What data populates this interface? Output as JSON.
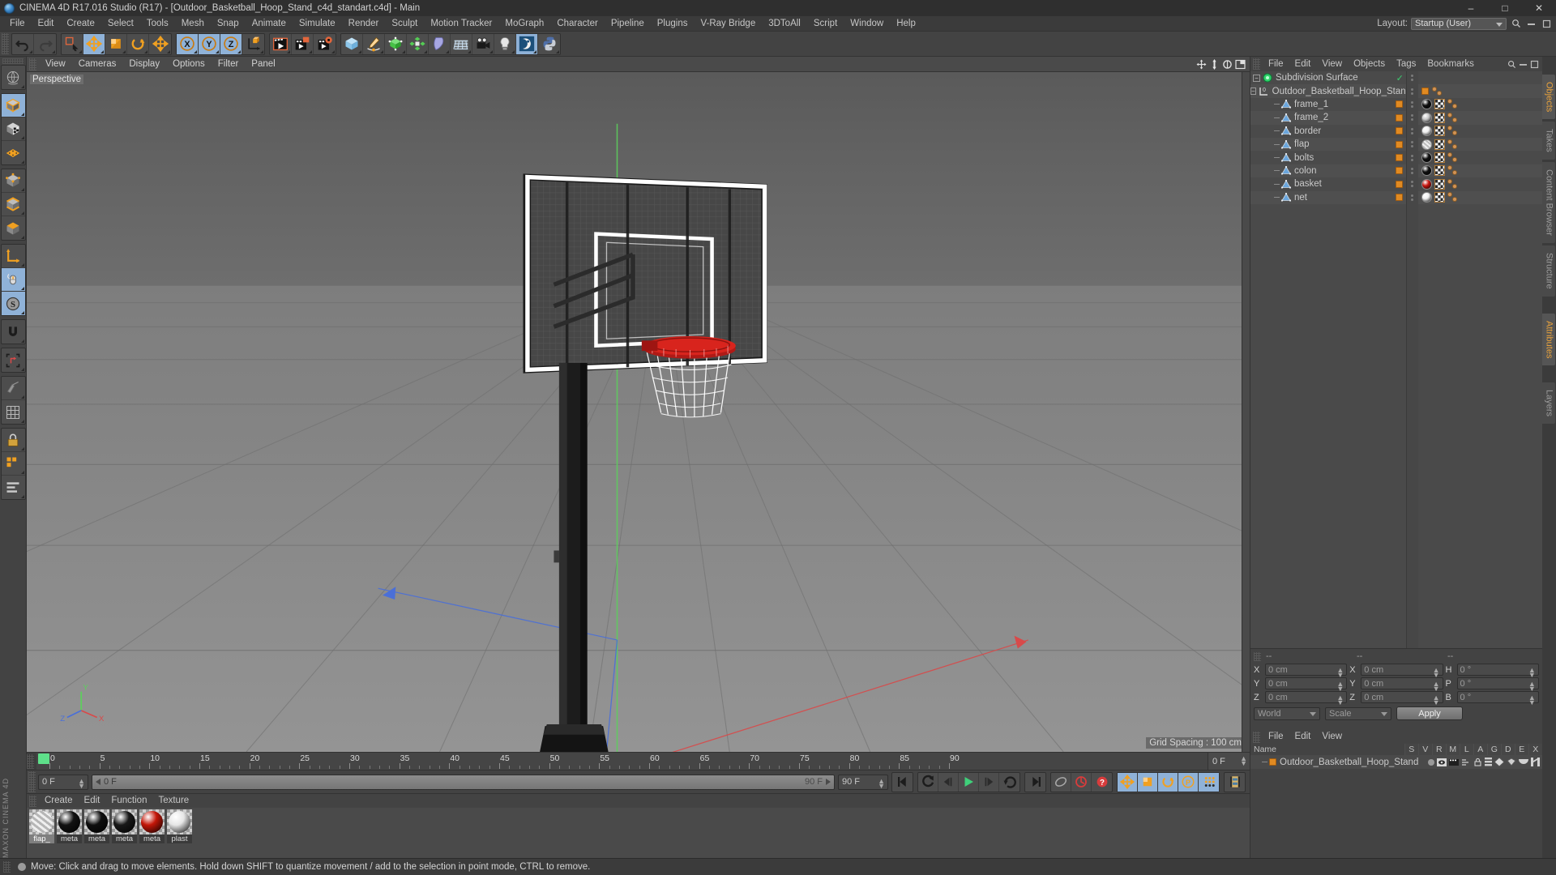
{
  "titlebar": {
    "title": "CINEMA 4D R17.016 Studio (R17) - [Outdoor_Basketball_Hoop_Stand_c4d_standart.c4d] - Main",
    "minimize": "–",
    "maximize": "□",
    "close": "✕"
  },
  "menubar": {
    "items": [
      "File",
      "Edit",
      "Create",
      "Select",
      "Tools",
      "Mesh",
      "Snap",
      "Animate",
      "Simulate",
      "Render",
      "Sculpt",
      "Motion Tracker",
      "MoGraph",
      "Character",
      "Pipeline",
      "Plugins",
      "V-Ray Bridge",
      "3DToAll",
      "Script",
      "Window",
      "Help"
    ],
    "layout_label": "Layout:",
    "layout_value": "Startup (User)"
  },
  "toolbar": {
    "groups": [
      {
        "name": "history",
        "buttons": [
          {
            "icon": "undo-icon",
            "selected": false
          },
          {
            "icon": "redo-icon",
            "selected": false
          }
        ]
      },
      {
        "name": "selection",
        "buttons": [
          {
            "icon": "live-selection-icon",
            "selected": false
          },
          {
            "icon": "move-icon",
            "selected": true
          },
          {
            "icon": "scale-icon",
            "selected": false
          },
          {
            "icon": "rotate-icon",
            "selected": false
          },
          {
            "icon": "move-dup-icon",
            "selected": false
          }
        ]
      },
      {
        "name": "axis",
        "buttons": [
          {
            "icon": "axis-x-icon",
            "selected": true
          },
          {
            "icon": "axis-y-icon",
            "selected": true
          },
          {
            "icon": "axis-z-icon",
            "selected": true
          },
          {
            "icon": "world-coordinate-icon",
            "selected": false
          }
        ]
      },
      {
        "name": "render",
        "buttons": [
          {
            "icon": "render-view-icon",
            "selected": false
          },
          {
            "icon": "render-region-icon",
            "selected": false
          },
          {
            "icon": "render-settings-icon",
            "selected": false
          }
        ]
      },
      {
        "name": "objects",
        "buttons": [
          {
            "icon": "cube-primitive-icon",
            "selected": false
          },
          {
            "icon": "spline-pen-icon",
            "selected": false
          },
          {
            "icon": "nurbs-generator-icon",
            "selected": false
          },
          {
            "icon": "array-deformer-icon",
            "selected": false
          },
          {
            "icon": "bend-deformer-icon",
            "selected": false
          },
          {
            "icon": "environment-floor-icon",
            "selected": false
          },
          {
            "icon": "camera-icon",
            "selected": false
          },
          {
            "icon": "light-icon",
            "selected": false
          },
          {
            "icon": "sculpt-icon",
            "selected": true
          },
          {
            "icon": "python-icon",
            "selected": false
          }
        ]
      }
    ]
  },
  "left_toolbar": {
    "buttons": [
      {
        "icon": "undo-view-icon",
        "selected": false
      },
      {
        "icon": "model-mode-icon",
        "selected": true
      },
      {
        "icon": "texture-mode-icon",
        "selected": false
      },
      {
        "icon": "points-mode-icon",
        "selected": false
      },
      {
        "icon": "edges-mode-icon",
        "selected": false
      },
      {
        "icon": "polygons-mode-icon",
        "selected": false
      },
      {
        "icon": "axis-mode-icon",
        "selected": false
      },
      {
        "icon": "object-axis-icon",
        "selected": false
      },
      {
        "icon": "viewport-solo-icon",
        "selected": true
      },
      {
        "icon": "workplane-icon",
        "selected": true
      },
      {
        "icon": "magnet-icon",
        "selected": false
      },
      {
        "icon": "enable-axis-icon",
        "selected": false
      },
      {
        "icon": "snap-icon",
        "selected": false
      },
      {
        "icon": "quantize-icon",
        "selected": false
      },
      {
        "icon": "lock-icon",
        "selected": false
      },
      {
        "icon": "grid-icon",
        "selected": false
      },
      {
        "icon": "align-icon",
        "selected": false
      }
    ]
  },
  "viewport": {
    "menu": [
      "View",
      "Cameras",
      "Display",
      "Options",
      "Filter",
      "Panel"
    ],
    "label": "Perspective",
    "grid_spacing": "Grid Spacing : 100 cm",
    "nav_icons": [
      "pan-icon",
      "dolly-icon",
      "rotate-view-icon",
      "maximize-view-icon"
    ]
  },
  "timeline": {
    "marks": [
      0,
      5,
      10,
      15,
      20,
      25,
      30,
      35,
      40,
      45,
      50,
      55,
      60,
      65,
      70,
      75,
      80,
      85,
      90
    ],
    "current_frame_field": "0 F",
    "current_frame_left": "0 F",
    "start_frame": "0 F",
    "end_frame": "90 F",
    "range_end": "90 F",
    "preview_end": "90 F"
  },
  "transport": {
    "buttons": [
      {
        "icon": "go-to-start-icon"
      },
      {
        "icon": "step-back-keyframe-icon"
      },
      {
        "icon": "play-reverse-icon"
      },
      {
        "icon": "play-forward-icon"
      },
      {
        "icon": "step-forward-keyframe-icon"
      },
      {
        "icon": "loop-icon"
      },
      {
        "icon": "go-to-end-icon"
      },
      {
        "icon": "record-active-objects-icon"
      },
      {
        "icon": "autokeying-icon"
      },
      {
        "icon": "keyframe-selection-icon"
      },
      {
        "icon": "position-key-icon"
      },
      {
        "icon": "scale-key-icon"
      },
      {
        "icon": "rotation-key-icon"
      },
      {
        "icon": "parameter-key-icon"
      },
      {
        "icon": "point-level-animation-icon"
      },
      {
        "icon": "timeline-icon"
      }
    ]
  },
  "material_manager": {
    "menu": [
      "Create",
      "Edit",
      "Function",
      "Texture"
    ],
    "materials": [
      {
        "name": "flap_",
        "color": "#d8d8d8",
        "selected": true
      },
      {
        "name": "meta",
        "color": "#121212",
        "selected": false
      },
      {
        "name": "meta",
        "color": "#0e0e0e",
        "selected": false
      },
      {
        "name": "meta",
        "color": "#181818",
        "selected": false
      },
      {
        "name": "meta",
        "color": "#c41608",
        "selected": false
      },
      {
        "name": "plast",
        "color": "#e6e6e6",
        "selected": false
      }
    ]
  },
  "statusbar": {
    "message": "Move: Click and drag to move elements. Hold down SHIFT to quantize movement / add to the selection in point mode, CTRL to remove."
  },
  "object_manager": {
    "menu": [
      "File",
      "Edit",
      "View",
      "Objects",
      "Tags",
      "Bookmarks"
    ],
    "header_icons": [
      "search-icon",
      "minimize-panel-icon",
      "maximize-panel-icon"
    ],
    "tree": [
      {
        "name": "Subdivision Surface",
        "depth": 0,
        "icon": "subdivision-surface-icon",
        "expander": true,
        "visible_dots": true,
        "check": true,
        "tags": []
      },
      {
        "name": "Outdoor_Basketball_Hoop_Stand",
        "depth": 1,
        "icon": "null-object-icon",
        "expander": true,
        "tags": []
      },
      {
        "name": "frame_1",
        "depth": 2,
        "icon": "polygon-object-icon",
        "tags": [
          "material-black",
          "uvw-tag",
          "beads"
        ]
      },
      {
        "name": "frame_2",
        "depth": 2,
        "icon": "polygon-object-icon",
        "tags": [
          "material-grey",
          "uvw-tag",
          "beads"
        ]
      },
      {
        "name": "border",
        "depth": 2,
        "icon": "polygon-object-icon",
        "tags": [
          "material-white",
          "uvw-tag",
          "beads"
        ]
      },
      {
        "name": "flap",
        "depth": 2,
        "icon": "polygon-object-icon",
        "tags": [
          "material-glass",
          "uvw-tag",
          "beads"
        ]
      },
      {
        "name": "bolts",
        "depth": 2,
        "icon": "polygon-object-icon",
        "tags": [
          "material-black",
          "uvw-tag",
          "beads"
        ]
      },
      {
        "name": "colon",
        "depth": 2,
        "icon": "polygon-object-icon",
        "tags": [
          "material-black",
          "uvw-tag",
          "beads"
        ]
      },
      {
        "name": "basket",
        "depth": 2,
        "icon": "polygon-object-icon",
        "tags": [
          "material-red",
          "uvw-tag",
          "beads"
        ]
      },
      {
        "name": "net",
        "depth": 2,
        "icon": "polygon-object-icon",
        "tags": [
          "material-white",
          "uvw-tag",
          "beads"
        ]
      }
    ],
    "side_tabs": [
      {
        "label": "Objects",
        "active": true
      },
      {
        "label": "Takes",
        "active": false
      },
      {
        "label": "Content Browser",
        "active": false
      },
      {
        "label": "Structure",
        "active": false
      }
    ]
  },
  "coordinates": {
    "col_headers": [
      "--",
      "--",
      "--"
    ],
    "rows": [
      {
        "axis": "X",
        "position": "0 cm",
        "axis2": "X",
        "size": "0 cm",
        "axis3": "H",
        "rotation": "0 °"
      },
      {
        "axis": "Y",
        "position": "0 cm",
        "axis2": "Y",
        "size": "0 cm",
        "axis3": "P",
        "rotation": "0 °"
      },
      {
        "axis": "Z",
        "position": "0 cm",
        "axis2": "Z",
        "size": "0 cm",
        "axis3": "B",
        "rotation": "0 °"
      }
    ],
    "coord_system": "World",
    "mode": "Scale",
    "apply_label": "Apply"
  },
  "object_list": {
    "menu": [
      "File",
      "Edit",
      "View"
    ],
    "name_header": "Name",
    "letters": [
      "S",
      "V",
      "R",
      "M",
      "L",
      "A",
      "G",
      "D",
      "E",
      "X"
    ],
    "rows": [
      {
        "name": "Outdoor_Basketball_Hoop_Stand"
      }
    ]
  },
  "right_edge_tabs": [
    {
      "label": "Attributes",
      "active": true
    },
    {
      "label": "Layers",
      "active": false
    }
  ],
  "branding": {
    "text": "MAXON CINEMA 4D"
  },
  "colors": {
    "accent_orange": "#e8a23c",
    "selection_blue": "#8fb2d8",
    "panel_bg": "#434343",
    "field_bg": "#4a4a4a",
    "green_marker": "#5ee08a"
  }
}
